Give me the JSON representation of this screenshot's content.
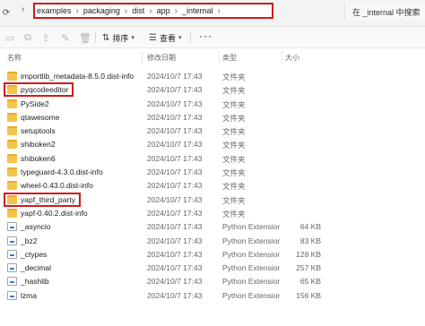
{
  "address_bar": {
    "path": [
      "examples",
      "packaging",
      "dist",
      "app",
      "_internal"
    ],
    "search_placeholder": "在 _internal 中搜索"
  },
  "toolbar": {
    "sort_label": "排序",
    "view_label": "查看",
    "more_label": "···"
  },
  "columns": {
    "name": "名称",
    "date": "修改日期",
    "type": "类型",
    "size": "大小"
  },
  "rows": [
    {
      "name": "importlib_metadata-8.5.0.dist-info",
      "date": "2024/10/7 17:43",
      "type": "文件夹",
      "size": "",
      "kind": "folder",
      "highlighted": false
    },
    {
      "name": "pyqcodeeditor",
      "date": "2024/10/7 17:43",
      "type": "文件夹",
      "size": "",
      "kind": "folder",
      "highlighted": true
    },
    {
      "name": "PySide2",
      "date": "2024/10/7 17:43",
      "type": "文件夹",
      "size": "",
      "kind": "folder",
      "highlighted": false
    },
    {
      "name": "qtawesome",
      "date": "2024/10/7 17:43",
      "type": "文件夹",
      "size": "",
      "kind": "folder",
      "highlighted": false
    },
    {
      "name": "setuptools",
      "date": "2024/10/7 17:43",
      "type": "文件夹",
      "size": "",
      "kind": "folder",
      "highlighted": false
    },
    {
      "name": "shiboken2",
      "date": "2024/10/7 17:43",
      "type": "文件夹",
      "size": "",
      "kind": "folder",
      "highlighted": false
    },
    {
      "name": "shiboken6",
      "date": "2024/10/7 17:43",
      "type": "文件夹",
      "size": "",
      "kind": "folder",
      "highlighted": false
    },
    {
      "name": "typeguard-4.3.0.dist-info",
      "date": "2024/10/7 17:43",
      "type": "文件夹",
      "size": "",
      "kind": "folder",
      "highlighted": false
    },
    {
      "name": "wheel-0.43.0.dist-info",
      "date": "2024/10/7 17:43",
      "type": "文件夹",
      "size": "",
      "kind": "folder",
      "highlighted": false
    },
    {
      "name": "yapf_third_party",
      "date": "2024/10/7 17:43",
      "type": "文件夹",
      "size": "",
      "kind": "folder",
      "highlighted": true
    },
    {
      "name": "yapf-0.40.2.dist-info",
      "date": "2024/10/7 17:43",
      "type": "文件夹",
      "size": "",
      "kind": "folder",
      "highlighted": false
    },
    {
      "name": "_asyncio",
      "date": "2024/10/7 17:43",
      "type": "Python Extension...",
      "size": "64 KB",
      "kind": "file",
      "highlighted": false
    },
    {
      "name": "_bz2",
      "date": "2024/10/7 17:43",
      "type": "Python Extension...",
      "size": "83 KB",
      "kind": "file",
      "highlighted": false
    },
    {
      "name": "_ctypes",
      "date": "2024/10/7 17:43",
      "type": "Python Extension...",
      "size": "128 KB",
      "kind": "file",
      "highlighted": false
    },
    {
      "name": "_decimal",
      "date": "2024/10/7 17:43",
      "type": "Python Extension...",
      "size": "257 KB",
      "kind": "file",
      "highlighted": false
    },
    {
      "name": "_hashlib",
      "date": "2024/10/7 17:43",
      "type": "Python Extension...",
      "size": "65 KB",
      "kind": "file",
      "highlighted": false
    },
    {
      "name": "lzma",
      "date": "2024/10/7 17:43",
      "type": "Python Extension...",
      "size": "156 KB",
      "kind": "file",
      "highlighted": false
    }
  ],
  "colors": {
    "highlight_border": "#d11a1a",
    "folder": "#f6c44b"
  }
}
